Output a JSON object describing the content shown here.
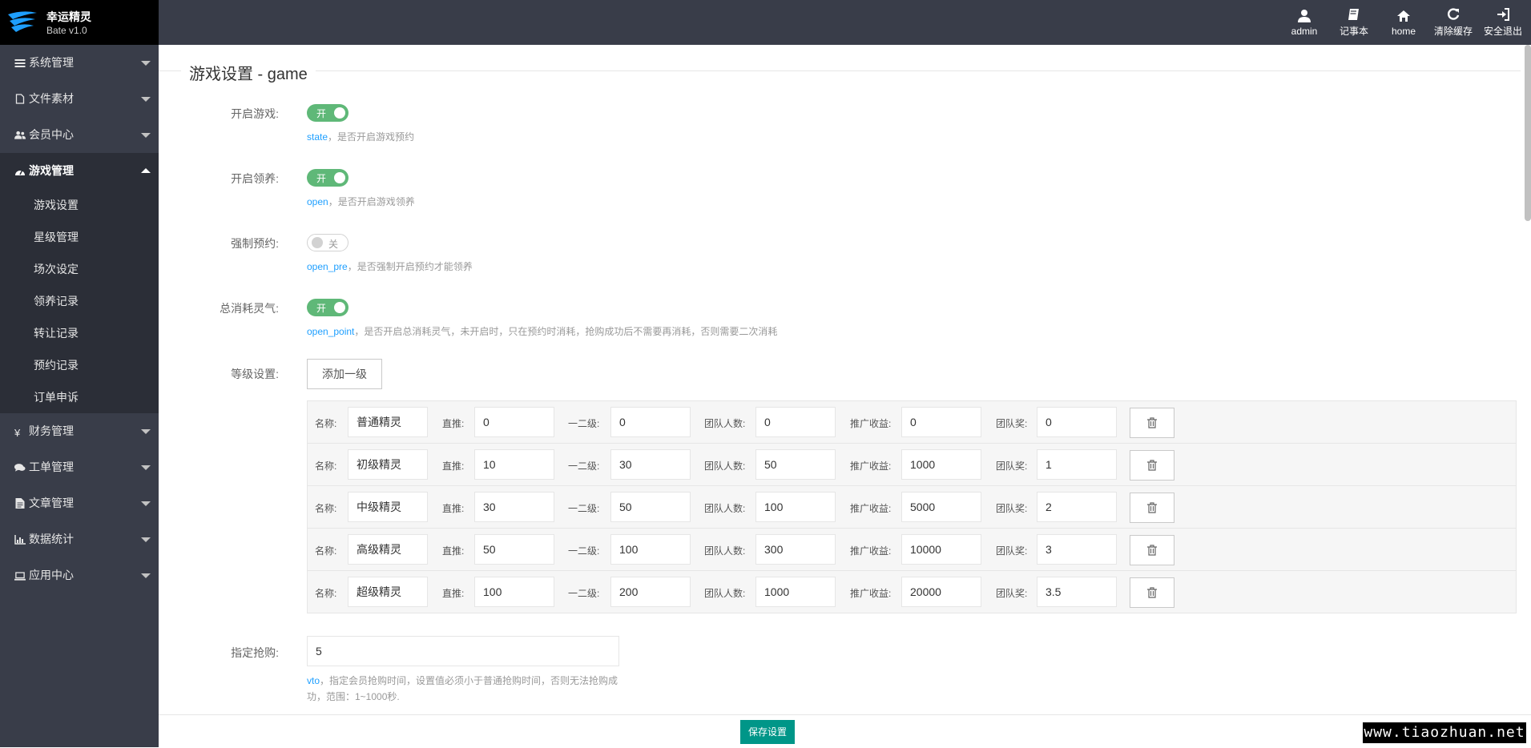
{
  "app": {
    "title": "幸运精灵",
    "version": "Bate v1.0"
  },
  "header_tools": [
    {
      "label": "admin",
      "icon": "user-icon"
    },
    {
      "label": "记事本",
      "icon": "book-icon"
    },
    {
      "label": "home",
      "icon": "home-icon"
    },
    {
      "label": "清除缓存",
      "icon": "refresh-icon"
    },
    {
      "label": "安全退出",
      "icon": "sign-out-icon"
    }
  ],
  "sidebar": {
    "items": [
      {
        "label": "系统管理",
        "icon": "list-icon"
      },
      {
        "label": "文件素材",
        "icon": "file-icon"
      },
      {
        "label": "会员中心",
        "icon": "users-icon"
      },
      {
        "label": "游戏管理",
        "icon": "dashboard-icon",
        "open": true,
        "children": [
          "游戏设置",
          "星级管理",
          "场次设定",
          "领养记录",
          "转让记录",
          "预约记录",
          "订单申诉"
        ]
      },
      {
        "label": "财务管理",
        "icon": "yen-icon"
      },
      {
        "label": "工单管理",
        "icon": "comments-icon"
      },
      {
        "label": "文章管理",
        "icon": "file-text-icon"
      },
      {
        "label": "数据统计",
        "icon": "bar-chart-icon"
      },
      {
        "label": "应用中心",
        "icon": "laptop-icon"
      }
    ]
  },
  "page": {
    "title": "游戏设置 - game"
  },
  "settings": [
    {
      "label": "开启游戏:",
      "state": "开",
      "on": true,
      "key": "state",
      "hint": "，是否开启游戏预约"
    },
    {
      "label": "开启领养:",
      "state": "开",
      "on": true,
      "key": "open",
      "hint": "，是否开启游戏领养"
    },
    {
      "label": "强制预约:",
      "state": "关",
      "on": false,
      "key": "open_pre",
      "hint": "，是否强制开启预约才能领养"
    },
    {
      "label": "总消耗灵气:",
      "state": "开",
      "on": true,
      "key": "open_point",
      "hint": "，是否开启总消耗灵气，未开启时，只在预约时消耗，抢购成功后不需要再消耗，否则需要二次消耗"
    }
  ],
  "levels": {
    "label": "等级设置:",
    "add_button": "添加一级",
    "field_labels": {
      "name": "名称:",
      "direct": "直推:",
      "second": "一二级:",
      "team_count": "团队人数:",
      "promo": "推广收益:",
      "team_award": "团队奖:"
    },
    "rows": [
      {
        "name": "普通精灵",
        "direct": "0",
        "second": "0",
        "team_count": "0",
        "promo": "0",
        "team_award": "0"
      },
      {
        "name": "初级精灵",
        "direct": "10",
        "second": "30",
        "team_count": "50",
        "promo": "1000",
        "team_award": "1"
      },
      {
        "name": "中级精灵",
        "direct": "30",
        "second": "50",
        "team_count": "100",
        "promo": "5000",
        "team_award": "2"
      },
      {
        "name": "高级精灵",
        "direct": "50",
        "second": "100",
        "team_count": "300",
        "promo": "10000",
        "team_award": "3"
      },
      {
        "name": "超级精灵",
        "direct": "100",
        "second": "200",
        "team_count": "1000",
        "promo": "20000",
        "team_award": "3.5"
      }
    ]
  },
  "vto": {
    "label": "指定抢购:",
    "value": "5",
    "key": "vto",
    "hint": "，指定会员抢购时间，设置值必须小于普通抢购时间，否则无法抢购成功，范围：1~1000秒."
  },
  "footer": {
    "save_label": "保存设置"
  },
  "watermark": "www.tiaozhuan.net",
  "colors": {
    "header": "#393d49",
    "sidebar": "#393d49",
    "submenu": "#2b2e37",
    "switch_on": "#5fb878",
    "primary": "#009688",
    "link": "#1e9fff"
  }
}
